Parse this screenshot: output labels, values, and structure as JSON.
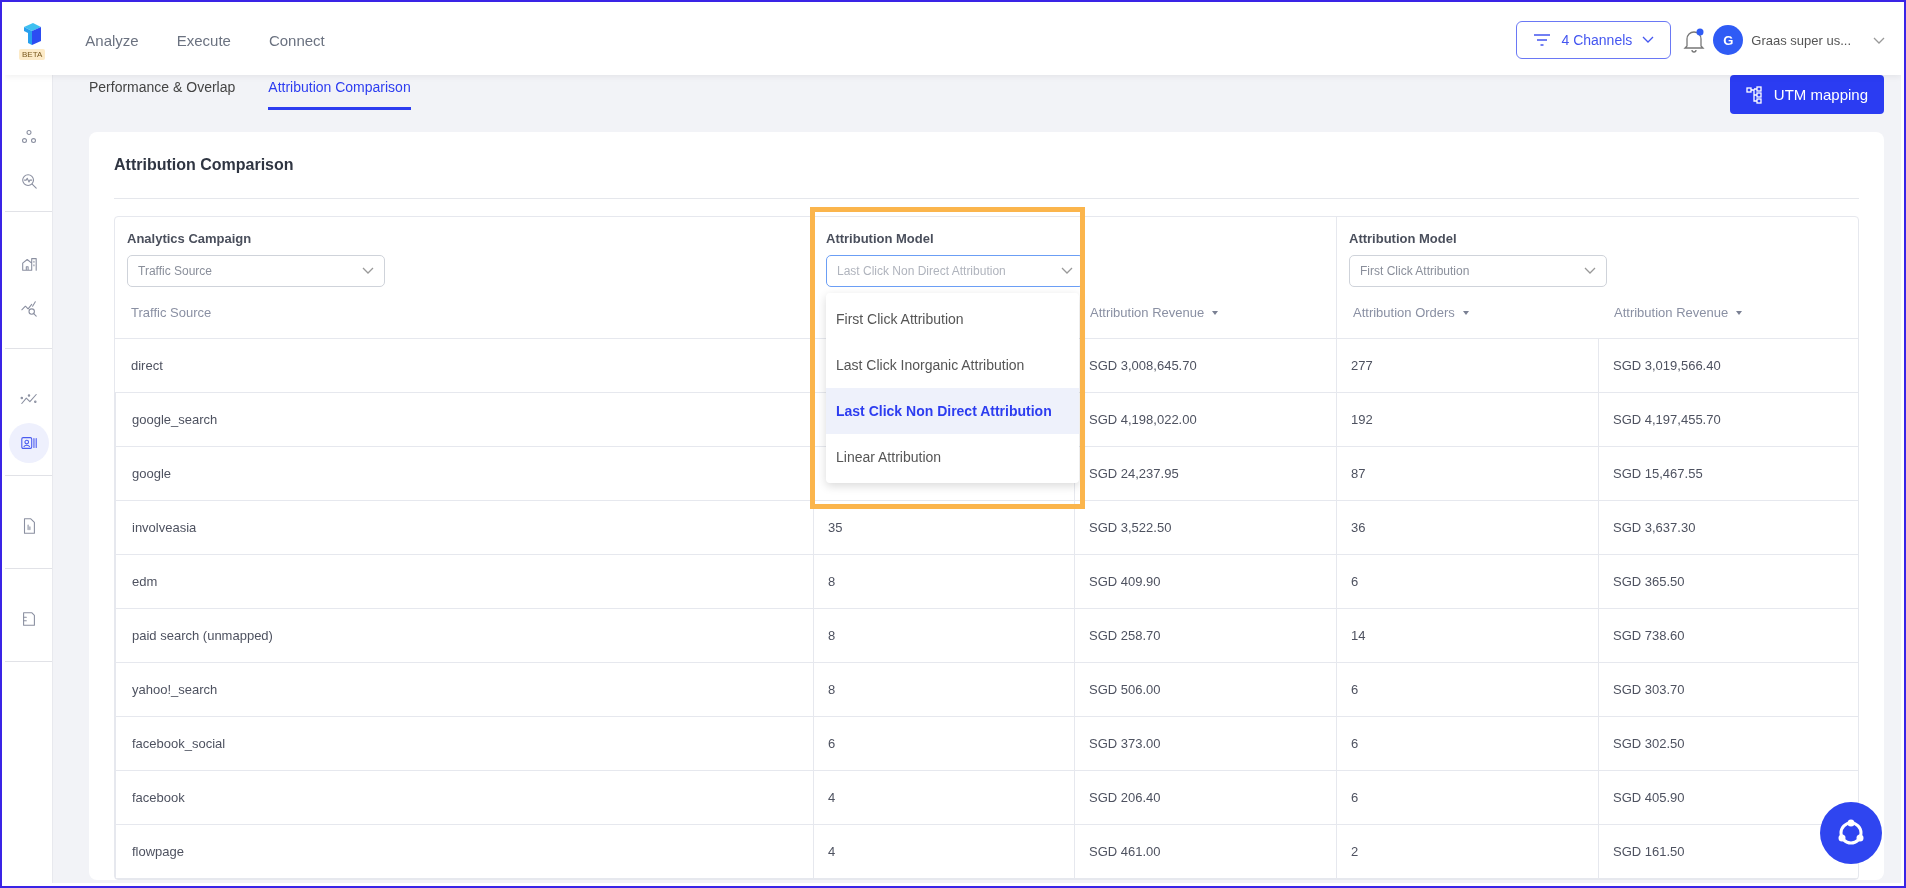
{
  "nav": {
    "beta_badge": "BETA",
    "items": [
      {
        "label": "Analyze",
        "selected": false
      },
      {
        "label": "Execute",
        "selected": false
      },
      {
        "label": "Connect",
        "selected": false
      }
    ]
  },
  "header": {
    "channels": "4 Channels",
    "user": {
      "initial": "G",
      "name": "Graas super us..."
    }
  },
  "sidebar": {
    "groups": [
      [
        {
          "kind": "nodes",
          "selected": false
        },
        {
          "kind": "search-pulse",
          "selected": false
        }
      ],
      [
        {
          "kind": "buildings",
          "selected": false
        },
        {
          "kind": "chart-search",
          "selected": false
        }
      ],
      [
        {
          "kind": "trend",
          "selected": false
        },
        {
          "kind": "id-card",
          "selected": true
        }
      ],
      [
        {
          "kind": "document",
          "selected": false
        }
      ],
      [
        {
          "kind": "file",
          "selected": false
        }
      ]
    ]
  },
  "tabs": [
    {
      "label": "Performance & Overlap",
      "selected": false
    },
    {
      "label": "Attribution Comparison",
      "selected": true
    }
  ],
  "utm_button": "UTM mapping",
  "card": {
    "title": "Attribution Comparison",
    "groups": [
      {
        "label": "Analytics Campaign",
        "select": "Traffic Source",
        "expanded": false,
        "highlighted": false
      },
      {
        "label": "Attribution Model",
        "select": "Last Click Non Direct Attribution",
        "expanded": true,
        "highlighted": true,
        "options": [
          {
            "label": "First Click Attribution",
            "selected": false
          },
          {
            "label": "Last Click Inorganic Attribution",
            "selected": false
          },
          {
            "label": "Last Click Non Direct Attribution",
            "selected": true
          },
          {
            "label": "Linear Attribution",
            "selected": false
          }
        ]
      },
      {
        "label": "Attribution Model",
        "select": "First Click Attribution",
        "expanded": false,
        "highlighted": false
      }
    ],
    "columns": [
      {
        "label": "Traffic Source",
        "sortable": false
      },
      null,
      {
        "label": "Attribution Revenue",
        "sortable": true
      },
      {
        "label": "Attribution Orders",
        "sortable": true
      },
      {
        "label": "Attribution Revenue",
        "sortable": true
      }
    ],
    "rows": [
      {
        "cells": [
          "direct",
          null,
          "SGD 3,008,645.70",
          "277",
          "SGD 3,019,566.40"
        ]
      },
      {
        "cells": [
          "google_search",
          null,
          "SGD 4,198,022.00",
          "192",
          "SGD 4,197,455.70"
        ]
      },
      {
        "cells": [
          "google",
          null,
          "SGD 24,237.95",
          "87",
          "SGD 15,467.55"
        ]
      },
      {
        "cells": [
          "involveasia",
          "35",
          "SGD 3,522.50",
          "36",
          "SGD 3,637.30"
        ]
      },
      {
        "cells": [
          "edm",
          "8",
          "SGD 409.90",
          "6",
          "SGD 365.50"
        ]
      },
      {
        "cells": [
          "paid search (unmapped)",
          "8",
          "SGD 258.70",
          "14",
          "SGD 738.60"
        ]
      },
      {
        "cells": [
          "yahoo!_search",
          "8",
          "SGD 506.00",
          "6",
          "SGD 303.70"
        ]
      },
      {
        "cells": [
          "facebook_social",
          "6",
          "SGD 373.00",
          "6",
          "SGD 302.50"
        ]
      },
      {
        "cells": [
          "facebook",
          "4",
          "SGD 206.40",
          "6",
          "SGD 405.90"
        ]
      },
      {
        "cells": [
          "flowpage",
          "4",
          "SGD 461.00",
          "2",
          "SGD 161.50"
        ]
      }
    ]
  }
}
